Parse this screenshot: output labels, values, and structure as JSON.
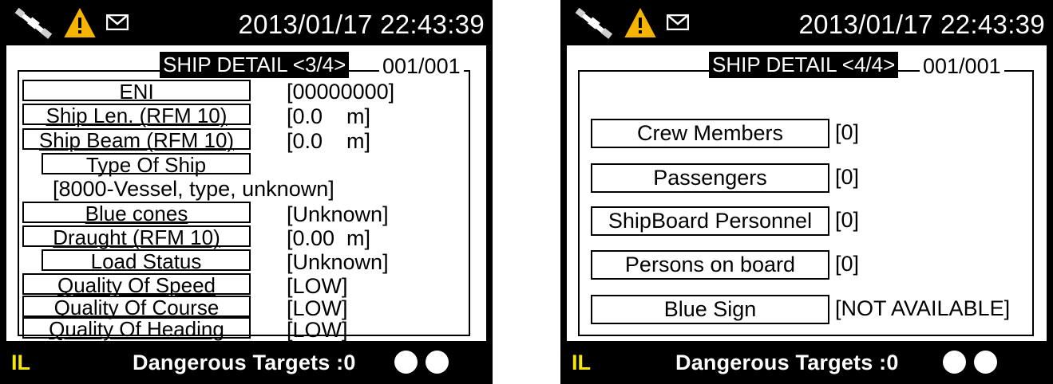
{
  "colors": {
    "background": "#000000",
    "panel": "#ffffff",
    "accent": "#f5e60a"
  },
  "left": {
    "datetime": "2013/01/17 22:43:39",
    "icons": [
      "satellite-icon",
      "warning-icon",
      "mail-icon"
    ],
    "title": "SHIP DETAIL <3/4>",
    "page_count": "001/001",
    "rows": [
      {
        "label": "ENI",
        "value": "[00000000]"
      },
      {
        "label": "Ship Len. (RFM 10)",
        "value": "[0.0    m]"
      },
      {
        "label": "Ship Beam (RFM 10)",
        "value": "[0.0    m]"
      },
      {
        "label": "Type Of Ship",
        "value": ""
      },
      {
        "label": "",
        "value": "[8000-Vessel, type, unknown]"
      },
      {
        "label": "Blue  cones",
        "value": "[Unknown]"
      },
      {
        "label": "Draught (RFM 10)",
        "value": "[0.00  m]"
      },
      {
        "label": "Load Status",
        "value": "[Unknown]"
      },
      {
        "label": "Quality Of Speed",
        "value": "[LOW]"
      },
      {
        "label": "Quality Of Course",
        "value": "[LOW]"
      },
      {
        "label": "Quality Of Heading",
        "value": "[LOW]"
      }
    ],
    "status_mode": "IL",
    "dangerous_targets": "Dangerous Targets :0"
  },
  "right": {
    "datetime": "2013/01/17 22:43:39",
    "icons": [
      "satellite-icon",
      "warning-icon",
      "mail-icon"
    ],
    "title": "SHIP DETAIL <4/4>",
    "page_count": "001/001",
    "rows": [
      {
        "label": "Crew Members",
        "value": "[0]"
      },
      {
        "label": "Passengers",
        "value": "[0]"
      },
      {
        "label": "ShipBoard Personnel",
        "value": "[0]"
      },
      {
        "label": "Persons on board",
        "value": "[0]"
      },
      {
        "label": "Blue Sign",
        "value": "[NOT AVAILABLE]"
      }
    ],
    "status_mode": "IL",
    "dangerous_targets": "Dangerous Targets :0"
  }
}
